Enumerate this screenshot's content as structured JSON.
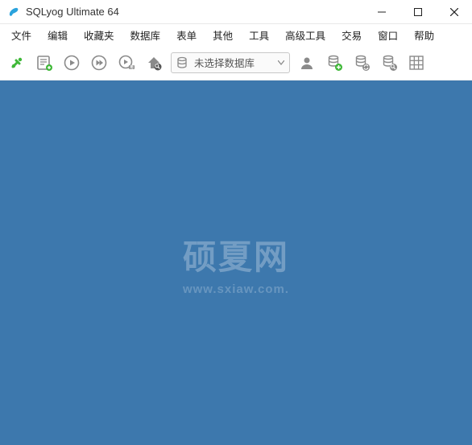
{
  "window": {
    "title": "SQLyog Ultimate 64"
  },
  "menu": {
    "items": [
      "文件",
      "编辑",
      "收藏夹",
      "数据库",
      "表单",
      "其他",
      "工具",
      "高级工具",
      "交易",
      "窗口",
      "帮助"
    ]
  },
  "toolbar": {
    "db_selector_text": "未选择数据库"
  },
  "watermark": {
    "main": "硕夏网",
    "url": "www.sxiaw.com."
  }
}
